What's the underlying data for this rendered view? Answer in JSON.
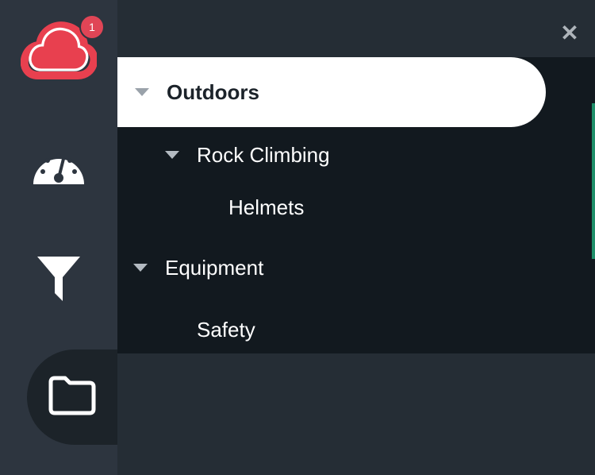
{
  "notifications": {
    "count": "1"
  },
  "icons": {
    "logo": "cloud-logo-icon",
    "dashboard": "speedometer-icon",
    "filter": "funnel-icon",
    "folder": "folder-icon",
    "close": "close-icon",
    "caret": "caret-down-icon"
  },
  "close_label": "✕",
  "tree": {
    "root": {
      "label": "Outdoors"
    },
    "child": {
      "label": "Rock Climbing"
    },
    "grandchild": {
      "label": "Helmets"
    },
    "second": {
      "label": "Equipment"
    },
    "second_child": {
      "label": "Safety"
    }
  },
  "colors": {
    "brand": "#e8404f",
    "rail": "#2d353f",
    "panel": "#252d35",
    "tree": "#12191f",
    "accent": "#1f8f6a"
  }
}
